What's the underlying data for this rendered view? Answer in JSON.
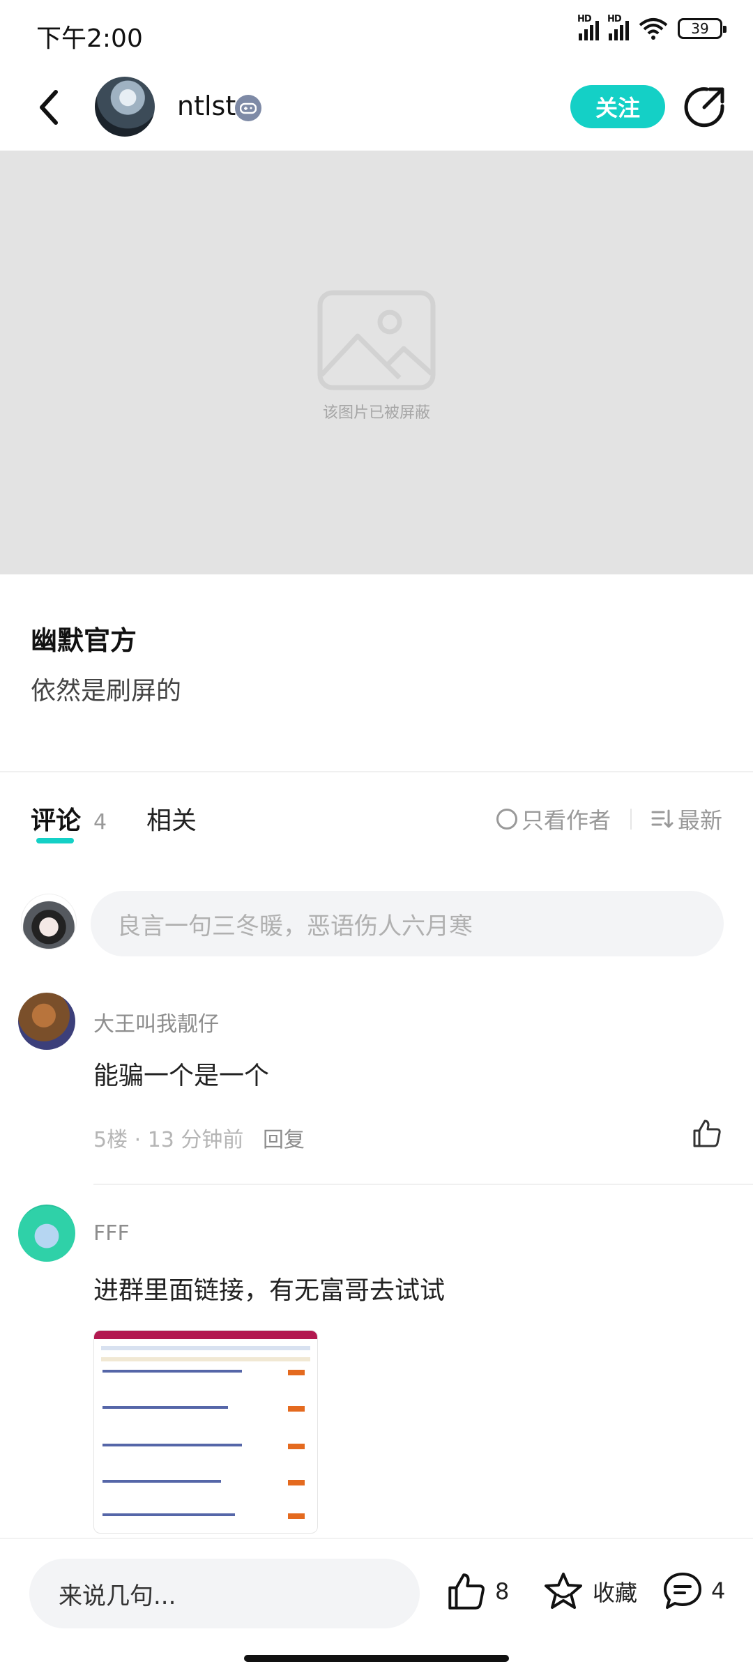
{
  "status_bar": {
    "time": "下午2:00",
    "signal_label_1": "HD",
    "signal_label_2": "HD",
    "battery": "39",
    "icons": [
      "signal-icon",
      "wifi-icon",
      "battery-icon"
    ]
  },
  "header": {
    "author_name": "ntlst",
    "follow_label": "关注",
    "icons": [
      "back-icon",
      "game-badge-icon",
      "share-icon"
    ]
  },
  "blocked_image": {
    "text": "该图片已被屏蔽",
    "icon": "image-placeholder-icon"
  },
  "post": {
    "title": "幽默官方",
    "body": "依然是刷屏的"
  },
  "tabs": {
    "comments_label": "评论",
    "comments_count": "4",
    "related_label": "相关",
    "author_only_label": "只看作者",
    "sort_label": "最新"
  },
  "comment_input": {
    "placeholder": "良言一句三冬暖，恶语伤人六月寒"
  },
  "comments": [
    {
      "user": "大王叫我靓仔",
      "text": "能骗一个是一个",
      "floor_time": "5楼 · 13 分钟前",
      "reply_label": "回复"
    },
    {
      "user": "FFF",
      "text": "进群里面链接，有无富哥去试试"
    }
  ],
  "bottom_bar": {
    "input_placeholder": "来说几句...",
    "like_count": "8",
    "favorite_label": "收藏",
    "comment_count": "4"
  },
  "colors": {
    "accent": "#14d0c6",
    "blocked_bg": "#e3e3e3",
    "input_bg": "#f3f4f6"
  }
}
